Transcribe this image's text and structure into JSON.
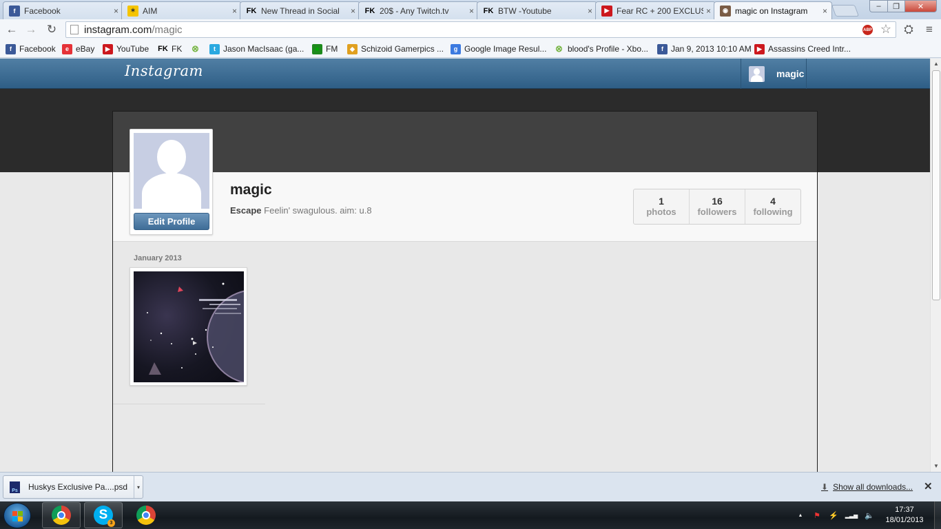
{
  "browser": {
    "tabs": [
      {
        "title": "Facebook",
        "icon": "facebook-icon",
        "color": "#3b5998",
        "glyph": "f"
      },
      {
        "title": "AIM",
        "icon": "aim-icon",
        "color": "#f5c400",
        "glyph": "✶"
      },
      {
        "title": "New Thread in Social",
        "icon": "fk-icon",
        "color": "#000000",
        "glyph": "FK"
      },
      {
        "title": "20$ - Any Twitch.tv",
        "icon": "fk-icon",
        "color": "#000000",
        "glyph": "FK"
      },
      {
        "title": "BTW -Youtube",
        "icon": "fk-icon",
        "color": "#000000",
        "glyph": "FK"
      },
      {
        "title": "Fear RC + 200 EXCLUS",
        "icon": "youtube-icon",
        "color": "#cc181e",
        "glyph": "▶"
      },
      {
        "title": "magic on Instagram",
        "icon": "instagram-icon",
        "color": "#7a5c45",
        "glyph": "◉"
      }
    ],
    "tab_close_glyph": "×",
    "window_controls": {
      "minimize": "–",
      "maximize": "❐",
      "close": "✕"
    },
    "toolbar": {
      "back": "←",
      "forward": "→",
      "reload": "↻",
      "extension": "⛭",
      "menu": "≡"
    },
    "address": {
      "host": "instagram.com",
      "path": "/magic"
    },
    "adblock_label": "ABP",
    "star": "☆",
    "bookmarks": [
      {
        "label": "Facebook",
        "icon": "facebook-icon",
        "color": "#3b5998",
        "glyph": "f"
      },
      {
        "label": "eBay",
        "icon": "ebay-icon",
        "color": "#e53238",
        "glyph": "e"
      },
      {
        "label": "YouTube",
        "icon": "youtube-icon",
        "color": "#cc181e",
        "glyph": "▶"
      },
      {
        "label": "FK",
        "icon": "fk-icon",
        "color": "#000000",
        "glyph": "FK"
      },
      {
        "label": "",
        "icon": "xbox-icon",
        "color": "#7ab648",
        "glyph": "⊗"
      },
      {
        "label": "Jason MacIsaac (ga...",
        "icon": "twitter-icon",
        "color": "#2aa9e0",
        "glyph": "t"
      },
      {
        "label": "FM",
        "icon": "fm-icon",
        "color": "#1d8a1d",
        "glyph": "■"
      },
      {
        "label": "Schizoid Gamerpics ...",
        "icon": "gamerpics-icon",
        "color": "#e0a020",
        "glyph": "◆"
      },
      {
        "label": "Google Image Resul...",
        "icon": "google-icon",
        "color": "#3c7ae0",
        "glyph": "g"
      },
      {
        "label": "blood's Profile - Xbo...",
        "icon": "xbox-icon",
        "color": "#7ab648",
        "glyph": "⊗"
      },
      {
        "label": "Jan 9, 2013 10:10 AM",
        "icon": "facebook-icon",
        "color": "#3b5998",
        "glyph": "f"
      },
      {
        "label": "Assassins Creed Intr...",
        "icon": "youtube-icon",
        "color": "#cc181e",
        "glyph": "▶"
      }
    ]
  },
  "instagram": {
    "logo": "Instagram",
    "header_user": "magic",
    "profile": {
      "username": "magic",
      "bio_name": "Escape",
      "bio_text": " Feelin' swagulous. aim: u.8",
      "edit_button": "Edit Profile",
      "stats": [
        {
          "value": "1",
          "label": "photos"
        },
        {
          "value": "16",
          "label": "followers"
        },
        {
          "value": "4",
          "label": "following"
        }
      ]
    },
    "feed": {
      "month": "January 2013"
    },
    "colors": {
      "header": "#3f6d97",
      "avatar_bg": "#c7cee3",
      "button": "#4a78a2"
    }
  },
  "downloads": {
    "file": "Huskys Exclusive Pa....psd",
    "file_icon_label": "Ps",
    "dropdown": "▾",
    "show_all": "Show all downloads...",
    "close": "✕"
  },
  "taskbar": {
    "clock_time": "17:37",
    "clock_date": "18/01/2013",
    "skype_glyph": "S",
    "skype_badge": "3",
    "tray_icons": [
      {
        "name": "show-hidden-icon",
        "glyph": "▲"
      },
      {
        "name": "network-error-icon",
        "glyph": "⚑"
      },
      {
        "name": "power-icon",
        "glyph": "⚡"
      },
      {
        "name": "signal-icon",
        "glyph": "▂▃▅"
      },
      {
        "name": "volume-icon",
        "glyph": "🔈"
      }
    ]
  }
}
